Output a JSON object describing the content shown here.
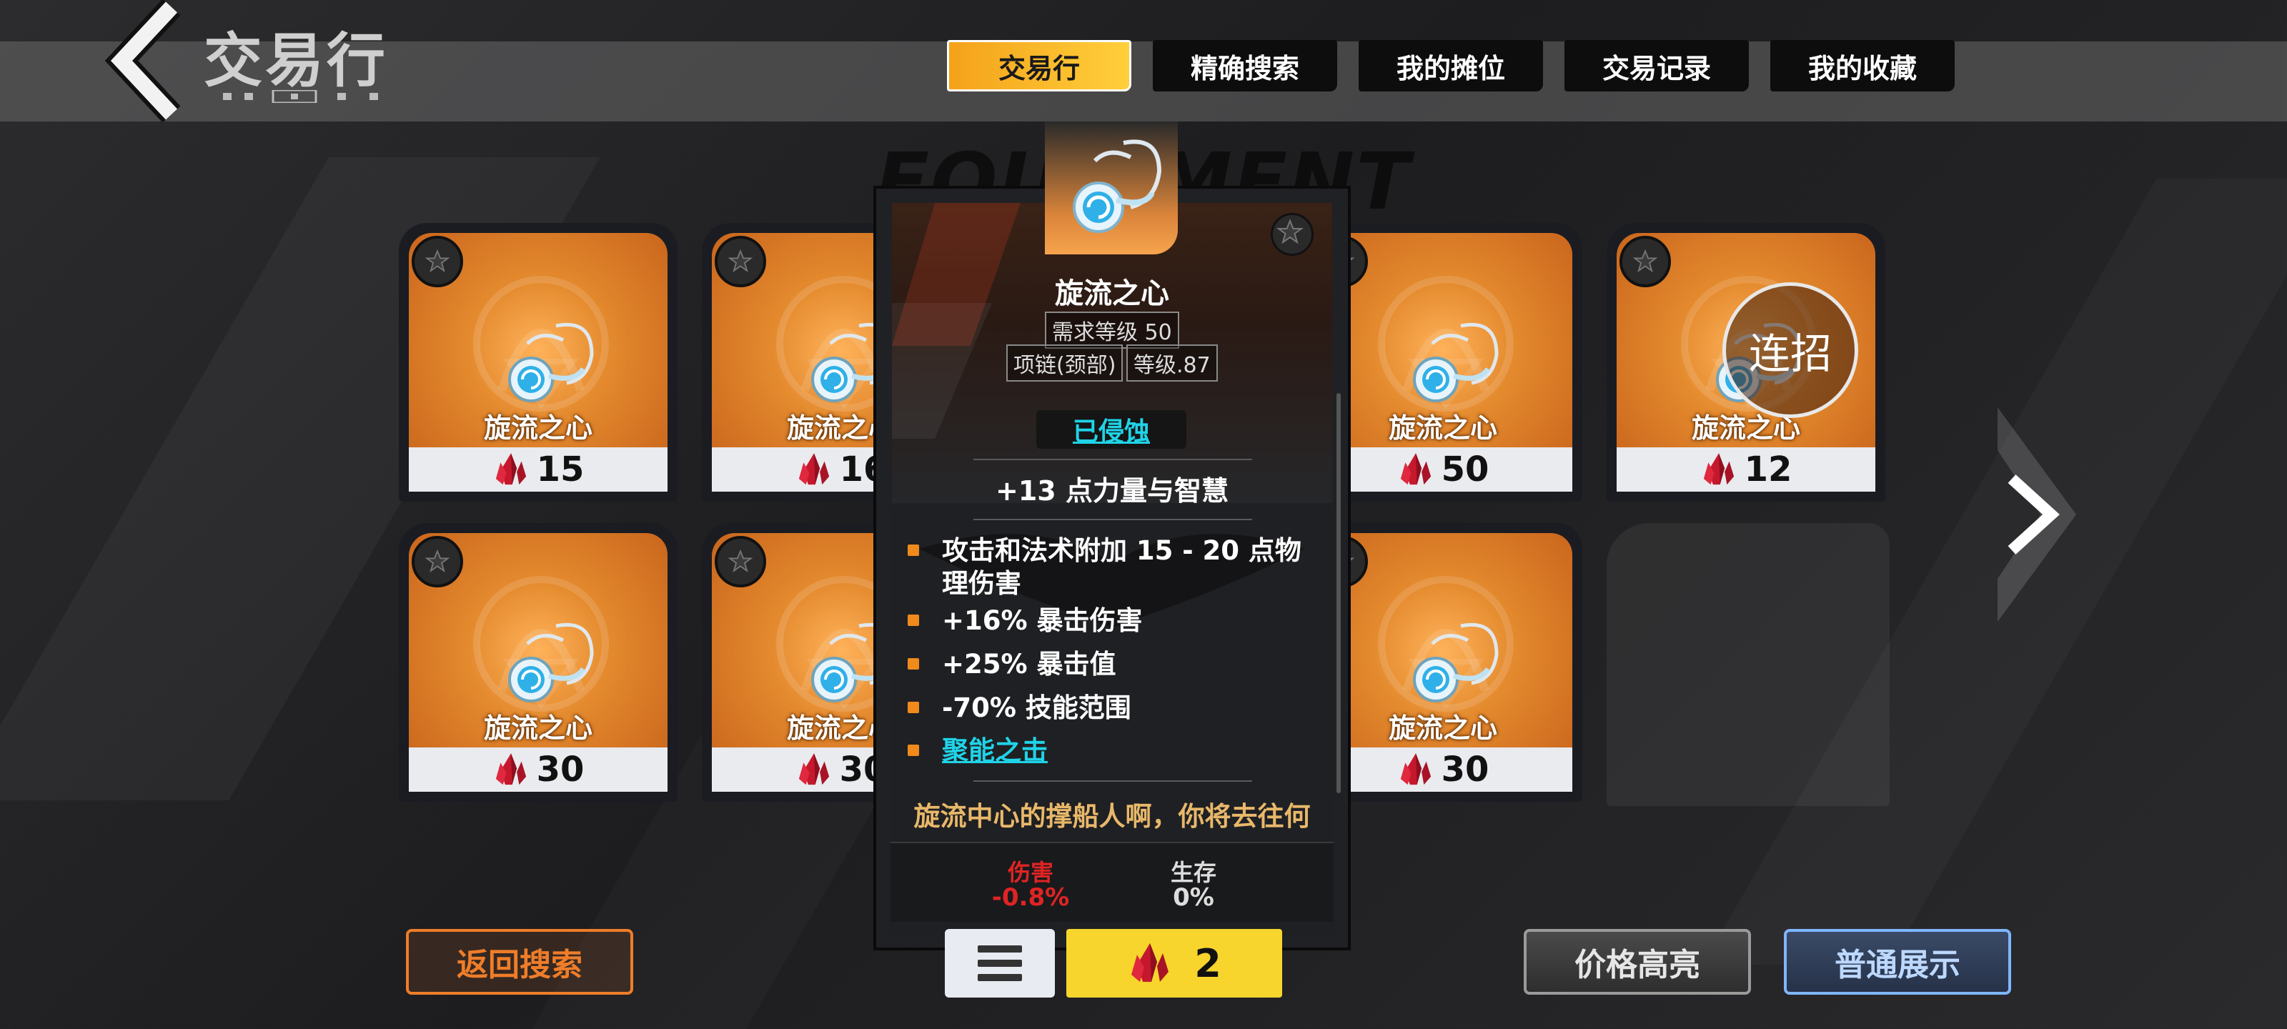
{
  "header": {
    "title": "交易行",
    "tabs": [
      {
        "label": "交易行",
        "active": true
      },
      {
        "label": "精确搜索",
        "active": false
      },
      {
        "label": "我的摊位",
        "active": false
      },
      {
        "label": "交易记录",
        "active": false
      },
      {
        "label": "我的收藏",
        "active": false
      }
    ]
  },
  "background_watermark": "EQUIPMENT",
  "listings": [
    {
      "name": "旋流之心",
      "price": "15"
    },
    {
      "name": "旋流之心",
      "price": "16"
    },
    {
      "name": "旋流之心",
      "price": "50"
    },
    {
      "name": "旋流之心",
      "price": "12"
    },
    {
      "name": "旋流之心",
      "price": "30"
    },
    {
      "name": "旋流之心",
      "price": "30"
    },
    {
      "name": "旋流之心",
      "price": "30"
    }
  ],
  "combo_button": "连招",
  "tooltip": {
    "name": "旋流之心",
    "required_level": "需求等级 50",
    "slot": "项链(颈部)",
    "item_level": "等级.87",
    "status": "已侵蚀",
    "implicit": "+13 点力量与智慧",
    "affixes": [
      {
        "text": "攻击和法术附加 15 - 20 点物理伤害",
        "link": false
      },
      {
        "text": "+16% 暴击伤害",
        "link": false
      },
      {
        "text": "+25% 暴击值",
        "link": false
      },
      {
        "text": "-70% 技能范围",
        "link": false
      },
      {
        "text": "聚能之击",
        "link": true
      }
    ],
    "flavor": "旋流中心的撑船人啊，你将去往何",
    "stats": [
      {
        "label": "伤害",
        "value": "-0.8%",
        "color": "#e02424"
      },
      {
        "label": "生存",
        "value": "0%",
        "color": "#dddddd"
      }
    ]
  },
  "bottom": {
    "back_search": "返回搜索",
    "buy_price": "2",
    "price_highlight": "价格高亮",
    "normal_display": "普通展示"
  },
  "colors": {
    "accent_orange": "#f08a1c",
    "tab_active": "#f4a21a",
    "link_cyan": "#1fd3e8",
    "flavor_gold": "#e8b86a",
    "buy_yellow": "#f7d52c",
    "normal_display_blue": "#7fb6ff"
  },
  "icons": [
    "back-chevron-icon",
    "star-icon",
    "necklace-icon",
    "crystal-icon",
    "next-arrow-icon",
    "menu-icon"
  ]
}
